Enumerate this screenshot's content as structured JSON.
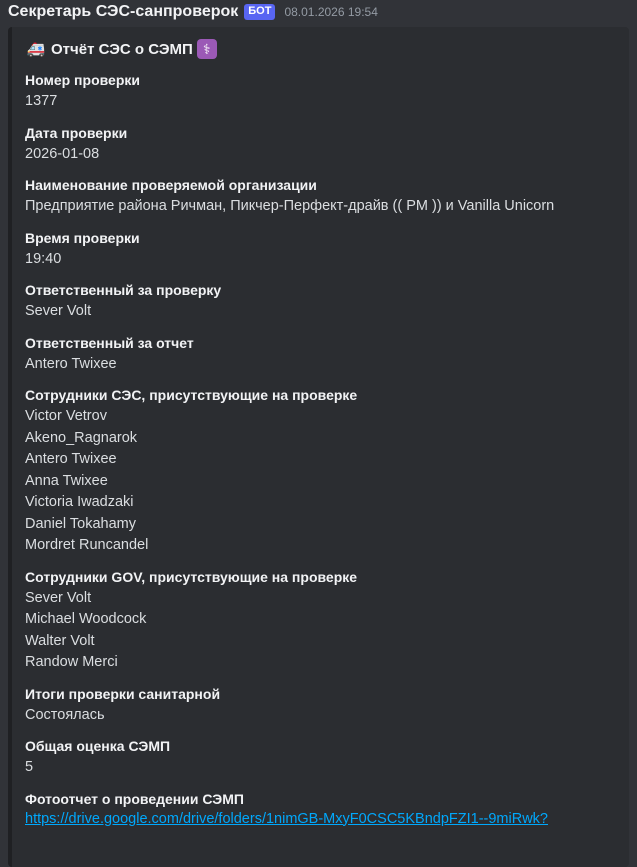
{
  "message": {
    "author": "Секретарь СЭС-санпроверок",
    "bot_tag": "БОТ",
    "timestamp": "08.01.2026 19:54"
  },
  "embed": {
    "title": "Отчёт СЭС о СЭМП",
    "title_icons": [
      "ambulance-emoji",
      "medical-symbol-emoji"
    ],
    "fields": [
      {
        "name": "Номер проверки",
        "values": [
          "1377"
        ]
      },
      {
        "name": "Дата проверки",
        "values": [
          "2026-01-08"
        ]
      },
      {
        "name": "Наименование проверяемой организации",
        "values": [
          "Предприятие района Ричман, Пикчер-Перфект-драйв (( PM )) и Vanilla Unicorn"
        ]
      },
      {
        "name": "Время проверки",
        "values": [
          "19:40"
        ]
      },
      {
        "name": "Ответственный за проверку",
        "values": [
          "Sever Volt"
        ]
      },
      {
        "name": "Ответственный за отчет",
        "values": [
          "Antero Twixee"
        ]
      },
      {
        "name": "Сотрудники СЭС, присутствующие на проверке",
        "values": [
          "Victor Vetrov",
          "Akeno_Ragnarok",
          "Antero Twixee",
          "Anna Twixee",
          "Victoria Iwadzaki",
          "Daniel Tokahamy",
          "Mordret Runcandel"
        ]
      },
      {
        "name": "Сотрудники GOV, присутствующие на проверке",
        "values": [
          "Sever Volt",
          "Michael Woodcock",
          "Walter Volt",
          "Randow Merci"
        ]
      },
      {
        "name": "Итоги проверки санитарной",
        "values": [
          "Состоялась"
        ]
      },
      {
        "name": "Общая оценка СЭМП",
        "values": [
          "5"
        ]
      }
    ],
    "photo_field": {
      "name": "Фотоотчет о проведении СЭМП",
      "link": "https://drive.google.com/drive/folders/1nimGB-MxyF0CSC5KBndpFZI1--9miRwk?"
    }
  },
  "colors": {
    "background": "#313338",
    "embed_background": "#2b2d31",
    "bot_tag": "#5865f2",
    "link": "#00a8fc"
  }
}
